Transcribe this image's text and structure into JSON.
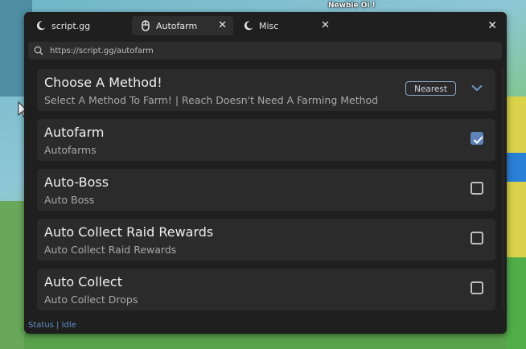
{
  "scene": {
    "nametag": "Newbie Oi !"
  },
  "tabs": [
    {
      "label": "script.gg",
      "icon": "moon-icon"
    },
    {
      "label": "Autofarm",
      "icon": "mouse-icon",
      "active": true
    },
    {
      "label": "Misc",
      "icon": "moon-icon"
    }
  ],
  "window": {
    "close": "✕"
  },
  "url": {
    "value": "https://script.gg/autofarm"
  },
  "items": [
    {
      "title": "Choose A Method!",
      "subtitle": "Select A Method To Farm! | Reach Doesn't Need A Farming Method",
      "type": "dropdown",
      "value": "Nearest"
    },
    {
      "title": "Autofarm",
      "subtitle": "Autofarms",
      "type": "checkbox",
      "checked": true
    },
    {
      "title": "Auto-Boss",
      "subtitle": "Auto Boss",
      "type": "checkbox",
      "checked": false
    },
    {
      "title": "Auto Collect Raid Rewards",
      "subtitle": "Auto Collect Raid Rewards",
      "type": "checkbox",
      "checked": false
    },
    {
      "title": "Auto Collect",
      "subtitle": "Auto Collect Drops",
      "type": "checkbox",
      "checked": false
    }
  ],
  "status": "Status | Idle",
  "colors": {
    "accent": "#5d83b9",
    "background": "#1f1f1f",
    "card": "#2b2b2b"
  }
}
